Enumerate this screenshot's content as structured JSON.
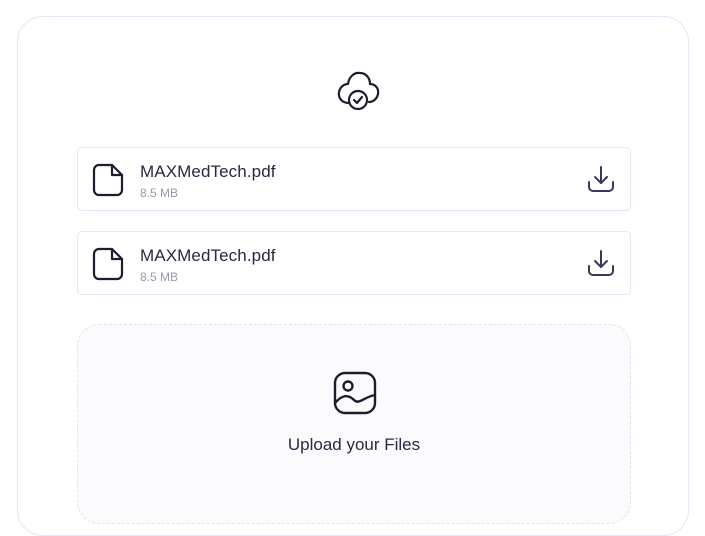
{
  "header": {
    "icon": "cloud-check-icon"
  },
  "files": [
    {
      "name": "MAXMedTech.pdf",
      "size": "8.5 MB",
      "icon": "file-icon",
      "action_icon": "download-icon"
    },
    {
      "name": "MAXMedTech.pdf",
      "size": "8.5 MB",
      "icon": "file-icon",
      "action_icon": "download-icon"
    }
  ],
  "dropzone": {
    "icon": "image-icon",
    "label": "Upload your Files"
  },
  "colors": {
    "text": "#2b2742",
    "muted": "#9a97ab",
    "border": "#e6e4f5",
    "dropzone_bg": "#fbfbfe"
  }
}
